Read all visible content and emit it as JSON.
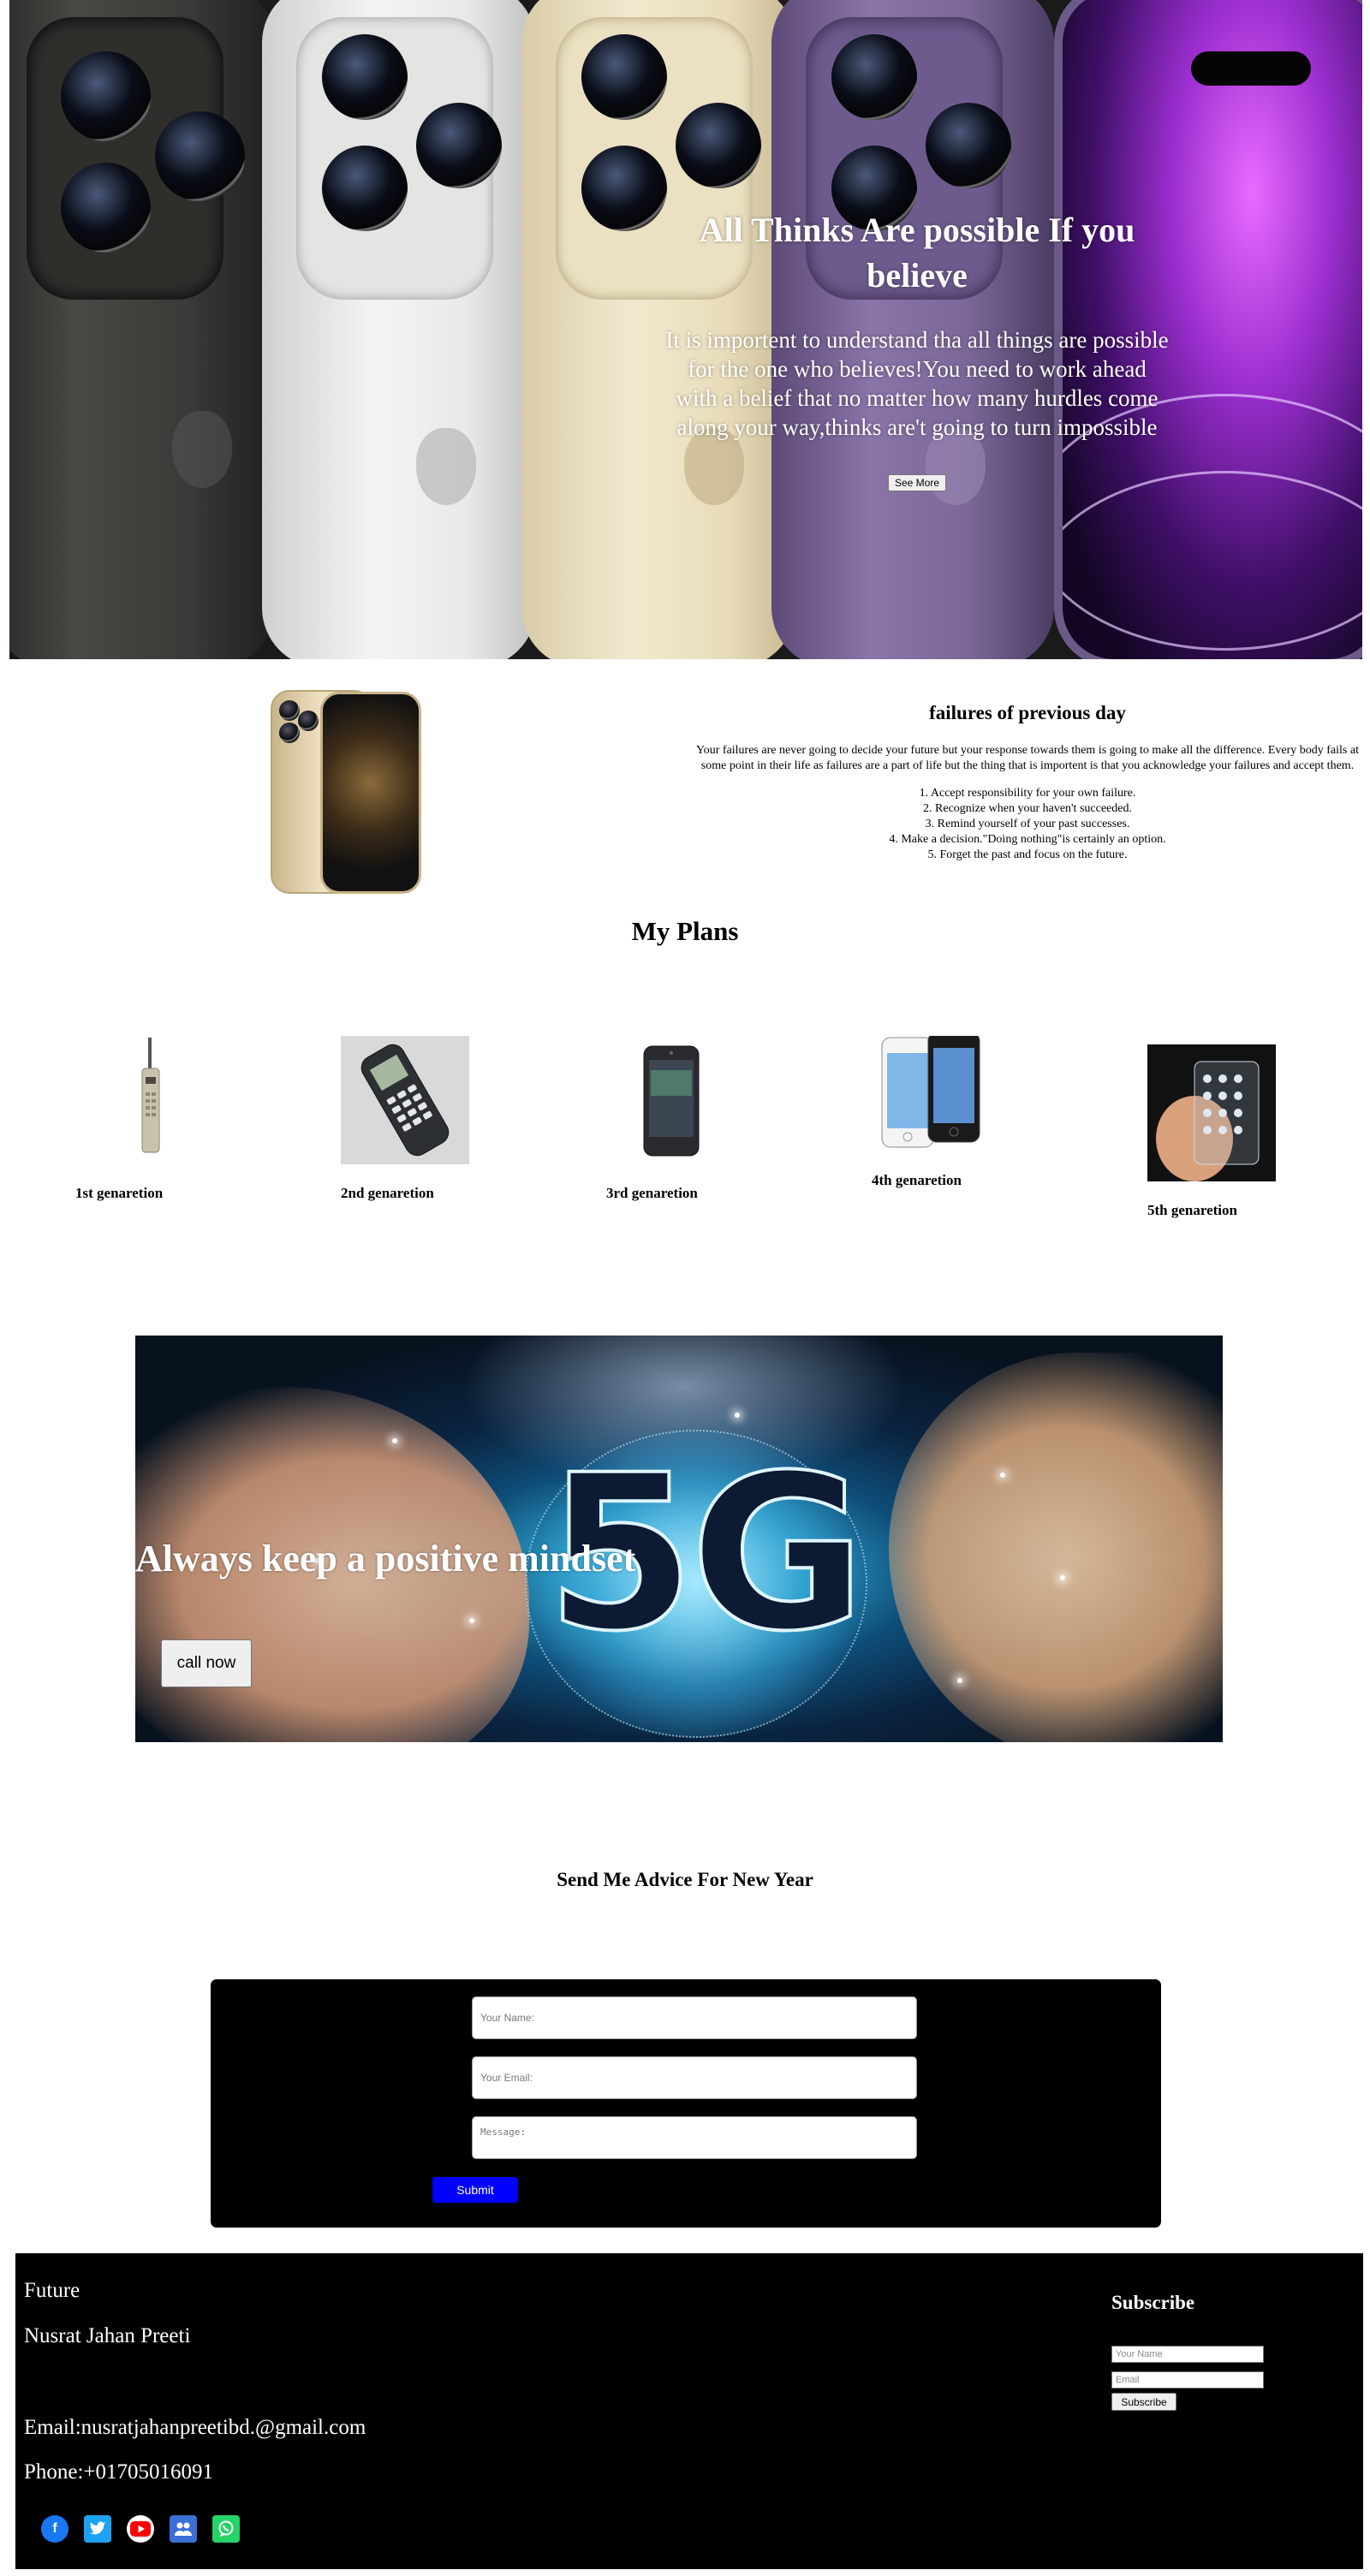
{
  "hero": {
    "title": "All Thinks Are possible If you believe",
    "description": "It is importent to understand tha all things are possible for the one who believes!You need to work ahead with a belief that no matter how many hurdles come along your way,thinks are't going to turn impossible",
    "button_label": "See More"
  },
  "failures": {
    "title": "failures of previous day",
    "description": "Your failures are never going to decide your future but your response towards them is going to make all the difference. Every body fails at some point in their life as failures are a part of life but the thing that is importent is that you acknowledge your failures and accept them.",
    "steps": [
      "1. Accept responsibility for your own failure.",
      "2. Recognize when your haven't succeeded.",
      "3. Remind yourself of your past successes.",
      "4. Make a decision.\"Doing nothing\"is certainly an option.",
      "5. Forget the past and focus on the future."
    ]
  },
  "plans": {
    "title": "My Plans",
    "generations": [
      {
        "label": "1st genaretion",
        "icon": "brick-phone-icon"
      },
      {
        "label": "2nd genaretion",
        "icon": "keypad-phone-icon"
      },
      {
        "label": "3rd genaretion",
        "icon": "smartphone-icon"
      },
      {
        "label": "4th genaretion",
        "icon": "iphone-pair-icon"
      },
      {
        "label": "5th genaretion",
        "icon": "transparent-phone-icon"
      }
    ]
  },
  "banner": {
    "title": "Always keep a positive mindset",
    "button_label": "call now",
    "image_text": "5G"
  },
  "advice": {
    "title": "Send Me Advice For New Year",
    "name_placeholder": "Your Name:",
    "email_placeholder": "Your Email:",
    "message_placeholder": "Message:",
    "submit_label": "Submit"
  },
  "footer": {
    "brand": "Future",
    "name": "Nusrat Jahan Preeti",
    "email": "Email:nusratjahanpreetibd.@gmail.com",
    "phone": "Phone:+01705016091",
    "subscribe": {
      "title": "Subscribe",
      "name_placeholder": "Your Name",
      "email_placeholder": "Email",
      "button_label": "Subscribe"
    },
    "social": [
      {
        "icon": "facebook-icon",
        "color": "#1877f2"
      },
      {
        "icon": "twitter-icon",
        "color": "#1da1f2"
      },
      {
        "icon": "youtube-icon",
        "color": "#ff0000"
      },
      {
        "icon": "contacts-icon",
        "color": "#3b6fd6"
      },
      {
        "icon": "whatsapp-icon",
        "color": "#25d366"
      }
    ]
  },
  "colors": {
    "submit_blue": "#0000ff",
    "form_background": "#000000",
    "footer_background": "#000000"
  }
}
